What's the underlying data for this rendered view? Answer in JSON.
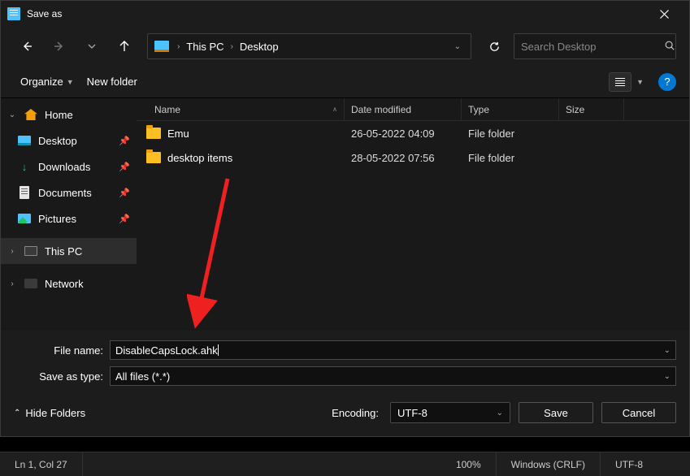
{
  "titlebar": {
    "title": "Save as"
  },
  "breadcrumb": {
    "pc": "This PC",
    "location": "Desktop"
  },
  "search": {
    "placeholder": "Search Desktop"
  },
  "toolbar": {
    "organize": "Organize",
    "newfolder": "New folder"
  },
  "sidebar": {
    "home": "Home",
    "desktop": "Desktop",
    "downloads": "Downloads",
    "documents": "Documents",
    "pictures": "Pictures",
    "thispc": "This PC",
    "network": "Network"
  },
  "columns": {
    "name": "Name",
    "date": "Date modified",
    "type": "Type",
    "size": "Size"
  },
  "files": [
    {
      "name": "Emu",
      "date": "26-05-2022 04:09",
      "type": "File folder",
      "size": ""
    },
    {
      "name": "desktop items",
      "date": "28-05-2022 07:56",
      "type": "File folder",
      "size": ""
    }
  ],
  "fields": {
    "filename_label": "File name:",
    "filename_value": "DisableCapsLock.ahk",
    "saveastype_label": "Save as type:",
    "saveastype_value": "All files  (*.*)"
  },
  "actions": {
    "hidefolders": "Hide Folders",
    "encoding_label": "Encoding:",
    "encoding_value": "UTF-8",
    "save": "Save",
    "cancel": "Cancel"
  },
  "statusbar": {
    "position": "Ln 1, Col 27",
    "zoom": "100%",
    "lineending": "Windows (CRLF)",
    "encoding": "UTF-8"
  }
}
